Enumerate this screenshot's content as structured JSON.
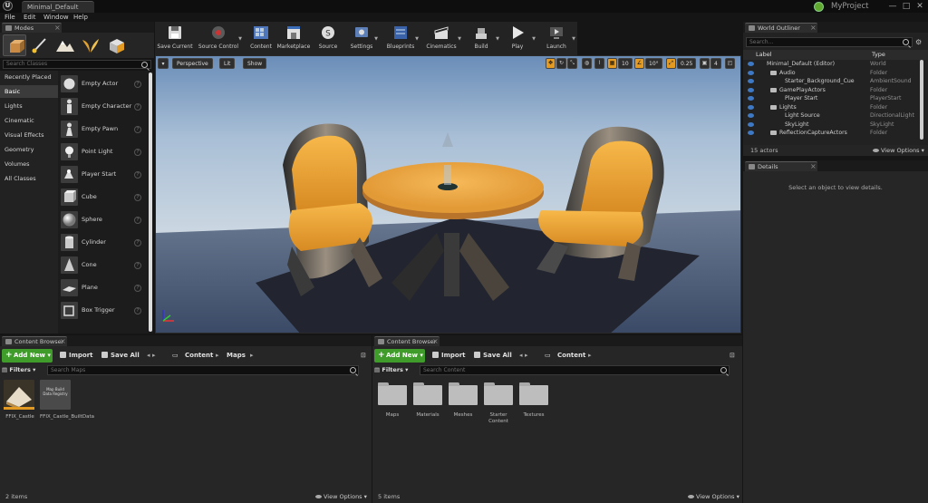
{
  "window": {
    "doc_tab": "Minimal_Default",
    "project_name": "MyProject",
    "minimize": "—",
    "maximize": "□",
    "close": "✕"
  },
  "menu": [
    "File",
    "Edit",
    "Window",
    "Help"
  ],
  "modes": {
    "tab_label": "Modes",
    "search_placeholder": "Search Classes",
    "categories": [
      "Recently Placed",
      "Basic",
      "Lights",
      "Cinematic",
      "Visual Effects",
      "Geometry",
      "Volumes",
      "All Classes"
    ],
    "selected_category": "Basic",
    "items": [
      "Empty Actor",
      "Empty Character",
      "Empty Pawn",
      "Point Light",
      "Player Start",
      "Cube",
      "Sphere",
      "Cylinder",
      "Cone",
      "Plane",
      "Box Trigger"
    ],
    "help_glyph": "?"
  },
  "toolbar": {
    "buttons": [
      "Save Current",
      "Source Control",
      "Content",
      "Marketplace",
      "Source",
      "Settings",
      "Blueprints",
      "Cinematics",
      "Build",
      "Play",
      "Launch"
    ]
  },
  "viewport": {
    "perspective": "Perspective",
    "lit": "Lit",
    "show": "Show",
    "grid_size": "10",
    "rotation_snap": "10°",
    "scale_snap": "0.25",
    "camera_speed": "4"
  },
  "world_outliner": {
    "tab_label": "World Outliner",
    "search_placeholder": "Search...",
    "col_label": "Label",
    "col_type": "Type",
    "rows": [
      {
        "label": "Minimal_Default (Editor)",
        "type": "World",
        "indent": 0
      },
      {
        "label": "Audio",
        "type": "Folder",
        "indent": 1
      },
      {
        "label": "Starter_Background_Cue",
        "type": "AmbientSound",
        "indent": 2
      },
      {
        "label": "GamePlayActors",
        "type": "Folder",
        "indent": 1
      },
      {
        "label": "Player Start",
        "type": "PlayerStart",
        "indent": 2
      },
      {
        "label": "Lights",
        "type": "Folder",
        "indent": 1
      },
      {
        "label": "Light Source",
        "type": "DirectionalLight",
        "indent": 2
      },
      {
        "label": "SkyLight",
        "type": "SkyLight",
        "indent": 2
      },
      {
        "label": "ReflectionCaptureActors",
        "type": "Folder",
        "indent": 1
      }
    ],
    "actor_count": "15 actors",
    "view_options": "View Options"
  },
  "details": {
    "tab_label": "Details",
    "empty_message": "Select an object to view details."
  },
  "content_browser_1": {
    "tab_label": "Content Browser 1",
    "add_new": "Add New",
    "import": "Import",
    "save_all": "Save All",
    "path": [
      "Content",
      "Maps"
    ],
    "filters": "Filters",
    "search_placeholder": "Search Maps",
    "assets": [
      {
        "name": "FFIX_Castle",
        "thumb_text": ""
      },
      {
        "name": "FFIX_Castle_BuiltData",
        "thumb_text": "Map Build Data Registry"
      }
    ],
    "item_count": "2 items",
    "view_options": "View Options"
  },
  "content_browser_2": {
    "tab_label": "Content Browser 2",
    "add_new": "Add New",
    "import": "Import",
    "save_all": "Save All",
    "path": [
      "Content"
    ],
    "filters": "Filters",
    "search_placeholder": "Search Content",
    "folders": [
      "Maps",
      "Materials",
      "Meshes",
      "Starter Content",
      "Textures"
    ],
    "item_count": "5 items",
    "view_options": "View Options"
  },
  "colors": {
    "accent_orange": "#e39a23",
    "add_new_green": "#3f9c2b",
    "panel_bg": "#262626",
    "chair_orange": "#f0a33c"
  }
}
